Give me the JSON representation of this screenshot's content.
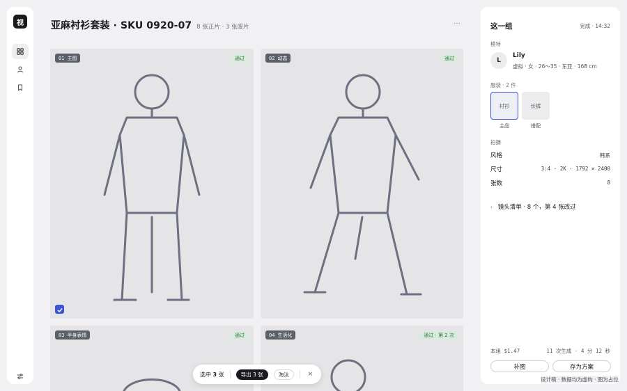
{
  "rail": {
    "logo": "视",
    "nav": [
      {
        "name": "grid",
        "icon": "grid-icon",
        "active": true
      },
      {
        "name": "person",
        "icon": "person-icon",
        "active": false
      },
      {
        "name": "bookmark",
        "icon": "bookmark-icon",
        "active": false
      }
    ],
    "bottom_icon": "sliders-icon"
  },
  "header": {
    "title": "亚麻衬衫套装 · SKU 0920-07",
    "subtitle": "8 张正片 · 3 张废片",
    "more": "···"
  },
  "cards": [
    {
      "index": "01",
      "label": "主图",
      "status": "通过",
      "selected": true
    },
    {
      "index": "02",
      "label": "动态",
      "status": "通过",
      "selected": false
    },
    {
      "index": "03",
      "label": "半身表情",
      "status": "通过",
      "selected": false
    },
    {
      "index": "04",
      "label": "生活化",
      "status": "通过 · 第 2 次",
      "selected": false
    }
  ],
  "selection_bar": {
    "count_prefix": "选中 ",
    "count": "3",
    "count_suffix": " 张",
    "export_label": "导出 3 张",
    "discard_label": "淘汰",
    "close": "×"
  },
  "panel": {
    "title": "这一组",
    "status": "完成 · 14:32",
    "model_label": "模特",
    "model": {
      "initial": "L",
      "name": "Lily",
      "desc": "虚拟 · 女 · 26～35 · 东亚 · 168 cm"
    },
    "garments_label": "服装 · 2 件",
    "garments": [
      {
        "name": "衬衫",
        "caption": "主品",
        "selected": true
      },
      {
        "name": "长裤",
        "caption": "搭配",
        "selected": false
      }
    ],
    "shoot_label": "拍摄",
    "shoot": [
      {
        "key": "风格",
        "value": "韩系"
      },
      {
        "key": "尺寸",
        "value": "3:4 · 2K · 1792 × 2400"
      },
      {
        "key": "张数",
        "value": "8"
      }
    ],
    "shot_list": "镜头清单 · 8 个，第 4 张改过",
    "cost": "本组 $1.47",
    "gen_info": "11 次生成 · 4 分 12 秒",
    "btn_regen": "补图",
    "btn_save": "存为方案"
  },
  "footnote": "设计稿 · 数据均为虚构 · 图为占位"
}
